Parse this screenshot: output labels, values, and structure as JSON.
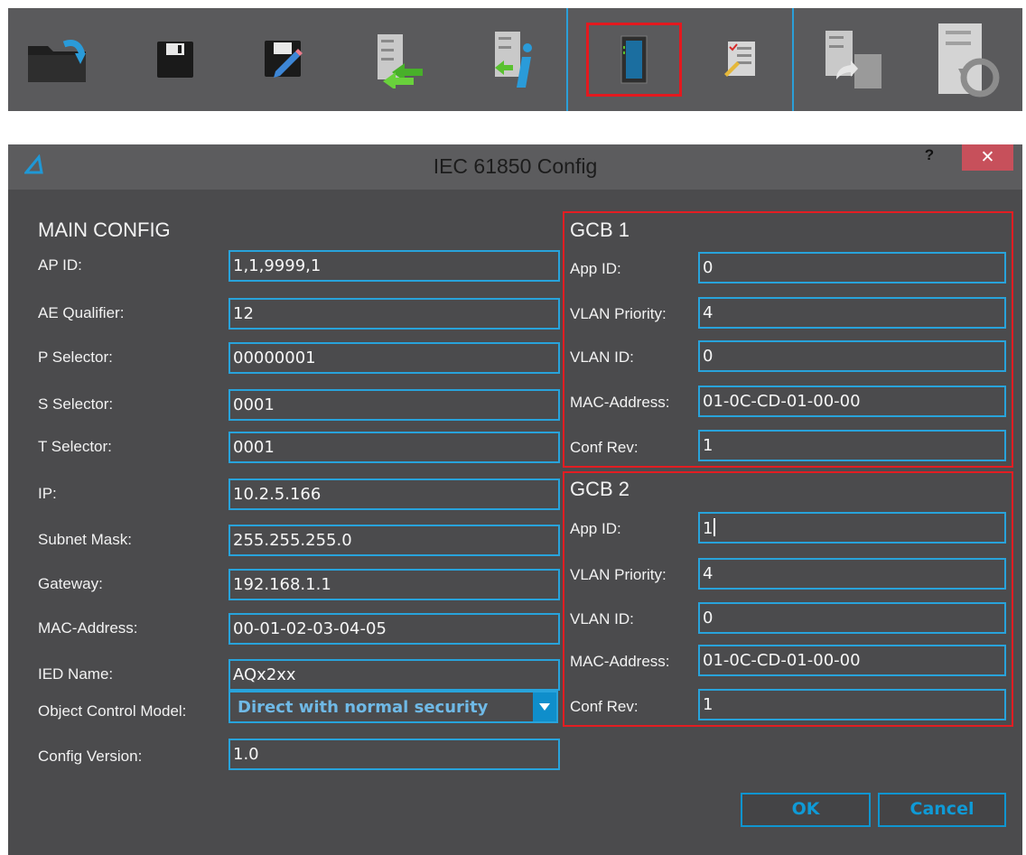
{
  "toolbar": {
    "buttons": [
      {
        "name": "open-file-icon"
      },
      {
        "name": "save-icon"
      },
      {
        "name": "save-as-icon"
      },
      {
        "name": "read-from-device-icon"
      },
      {
        "name": "device-info-icon"
      },
      {
        "name": "iec61850-config-icon",
        "selected": true
      },
      {
        "name": "checklist-icon"
      },
      {
        "name": "export-icon"
      },
      {
        "name": "restore-icon"
      }
    ],
    "accent_color": "#2b9fd8",
    "highlight_color": "#e3191f"
  },
  "dialog": {
    "title": "IEC 61850 Config",
    "help_label": "?",
    "close_label": "✕",
    "main_config": {
      "title": "MAIN CONFIG",
      "fields": [
        {
          "label": "AP ID:",
          "value": "1,1,9999,1"
        },
        {
          "label": "AE Qualifier:",
          "value": "12"
        },
        {
          "label": "P Selector:",
          "value": "00000001"
        },
        {
          "label": "S Selector:",
          "value": "0001"
        },
        {
          "label": "T Selector:",
          "value": "0001"
        },
        {
          "label": "IP:",
          "value": "10.2.5.166"
        },
        {
          "label": "Subnet Mask:",
          "value": "255.255.255.0"
        },
        {
          "label": "Gateway:",
          "value": "192.168.1.1"
        },
        {
          "label": "MAC-Address:",
          "value": "00-01-02-03-04-05"
        },
        {
          "label": "IED Name:",
          "value": "AQx2xx"
        },
        {
          "label": "Object Control Model:",
          "value": "Direct with normal security"
        },
        {
          "label": "Config Version:",
          "value": "1.0"
        }
      ]
    },
    "gcb1": {
      "title": "GCB 1",
      "fields": [
        {
          "label": "App ID:",
          "value": "0"
        },
        {
          "label": "VLAN Priority:",
          "value": "4"
        },
        {
          "label": "VLAN ID:",
          "value": "0"
        },
        {
          "label": "MAC-Address:",
          "value": "01-0C-CD-01-00-00"
        },
        {
          "label": "Conf Rev:",
          "value": "1"
        }
      ]
    },
    "gcb2": {
      "title": "GCB 2",
      "fields": [
        {
          "label": "App ID:",
          "value": "1"
        },
        {
          "label": "VLAN Priority:",
          "value": "4"
        },
        {
          "label": "VLAN ID:",
          "value": "0"
        },
        {
          "label": "MAC-Address:",
          "value": "01-0C-CD-01-00-00"
        },
        {
          "label": "Conf Rev:",
          "value": "1"
        }
      ]
    },
    "ok_label": "OK",
    "cancel_label": "Cancel",
    "colors": {
      "field_border": "#28a3db",
      "gcb_border": "#e31d22",
      "close_button": "#c7505b"
    }
  }
}
